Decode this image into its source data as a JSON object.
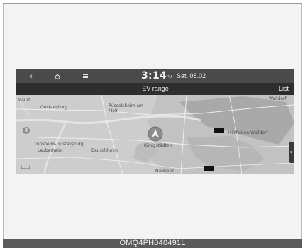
{
  "status_bar": {
    "back_icon": "chevron-left",
    "home_icon": "home",
    "menu_icon": "menu",
    "time": "3:14",
    "ampm": "PM",
    "date": "Sat, 08.02"
  },
  "title_bar": {
    "title": "EV range",
    "list_label": "List"
  },
  "map": {
    "labels": {
      "gustavsburg": "Gustavsburg",
      "russelsheim": "Rüsselsheim am Main",
      "ginsheim": "Ginsheim-Gustavsburg",
      "lauberheim": "Lauberheim",
      "bauschheim": "Bauschheim",
      "konigstadten": "Königstädten",
      "walldorf": "Walldorf",
      "morfelden": "Mörfelden-Walldorf",
      "nauheim": "Nauheim",
      "mainz_partial": "Mainz"
    },
    "side_tab_icon": "chevron-left"
  },
  "caption": "OMQ4PH040491L"
}
